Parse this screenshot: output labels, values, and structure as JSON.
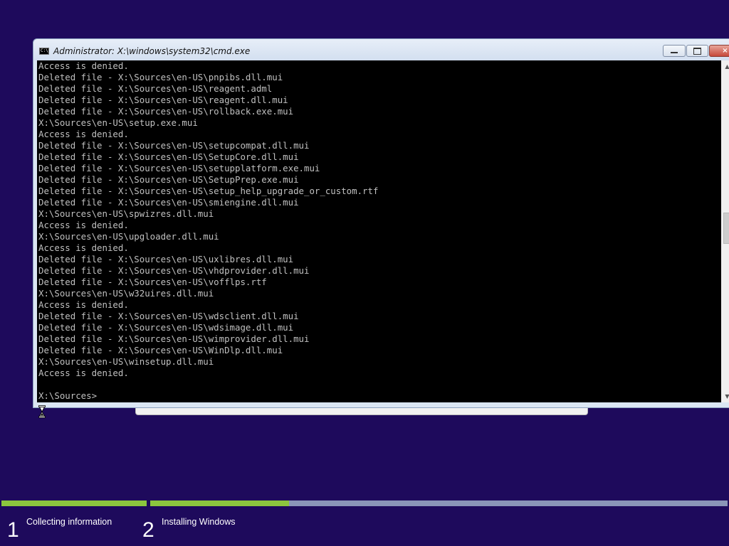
{
  "window": {
    "title": "Administrator: X:\\windows\\system32\\cmd.exe",
    "buttons": {
      "minimize": "minimize",
      "maximize": "maximize",
      "close": "×"
    },
    "icon": "console-icon"
  },
  "console": {
    "lines": [
      "Access is denied.",
      "Deleted file - X:\\Sources\\en-US\\pnpibs.dll.mui",
      "Deleted file - X:\\Sources\\en-US\\reagent.adml",
      "Deleted file - X:\\Sources\\en-US\\reagent.dll.mui",
      "Deleted file - X:\\Sources\\en-US\\rollback.exe.mui",
      "X:\\Sources\\en-US\\setup.exe.mui",
      "Access is denied.",
      "Deleted file - X:\\Sources\\en-US\\setupcompat.dll.mui",
      "Deleted file - X:\\Sources\\en-US\\SetupCore.dll.mui",
      "Deleted file - X:\\Sources\\en-US\\setupplatform.exe.mui",
      "Deleted file - X:\\Sources\\en-US\\SetupPrep.exe.mui",
      "Deleted file - X:\\Sources\\en-US\\setup_help_upgrade_or_custom.rtf",
      "Deleted file - X:\\Sources\\en-US\\smiengine.dll.mui",
      "X:\\Sources\\en-US\\spwizres.dll.mui",
      "Access is denied.",
      "X:\\Sources\\en-US\\upgloader.dll.mui",
      "Access is denied.",
      "Deleted file - X:\\Sources\\en-US\\uxlibres.dll.mui",
      "Deleted file - X:\\Sources\\en-US\\vhdprovider.dll.mui",
      "Deleted file - X:\\Sources\\en-US\\vofflps.rtf",
      "X:\\Sources\\en-US\\w32uires.dll.mui",
      "Access is denied.",
      "Deleted file - X:\\Sources\\en-US\\wdsclient.dll.mui",
      "Deleted file - X:\\Sources\\en-US\\wdsimage.dll.mui",
      "Deleted file - X:\\Sources\\en-US\\wimprovider.dll.mui",
      "Deleted file - X:\\Sources\\en-US\\WinDlp.dll.mui",
      "X:\\Sources\\en-US\\winsetup.dll.mui",
      "Access is denied.",
      "",
      "X:\\Sources>"
    ],
    "text_color": "#c0c0c0",
    "background": "#000000"
  },
  "setup": {
    "steps": [
      {
        "number": "1",
        "label": "Collecting information",
        "progress": 1.0
      },
      {
        "number": "2",
        "label": "Installing Windows",
        "progress": 0.24
      }
    ],
    "accent": "#8cc63e",
    "background": "#1e0a5c"
  }
}
